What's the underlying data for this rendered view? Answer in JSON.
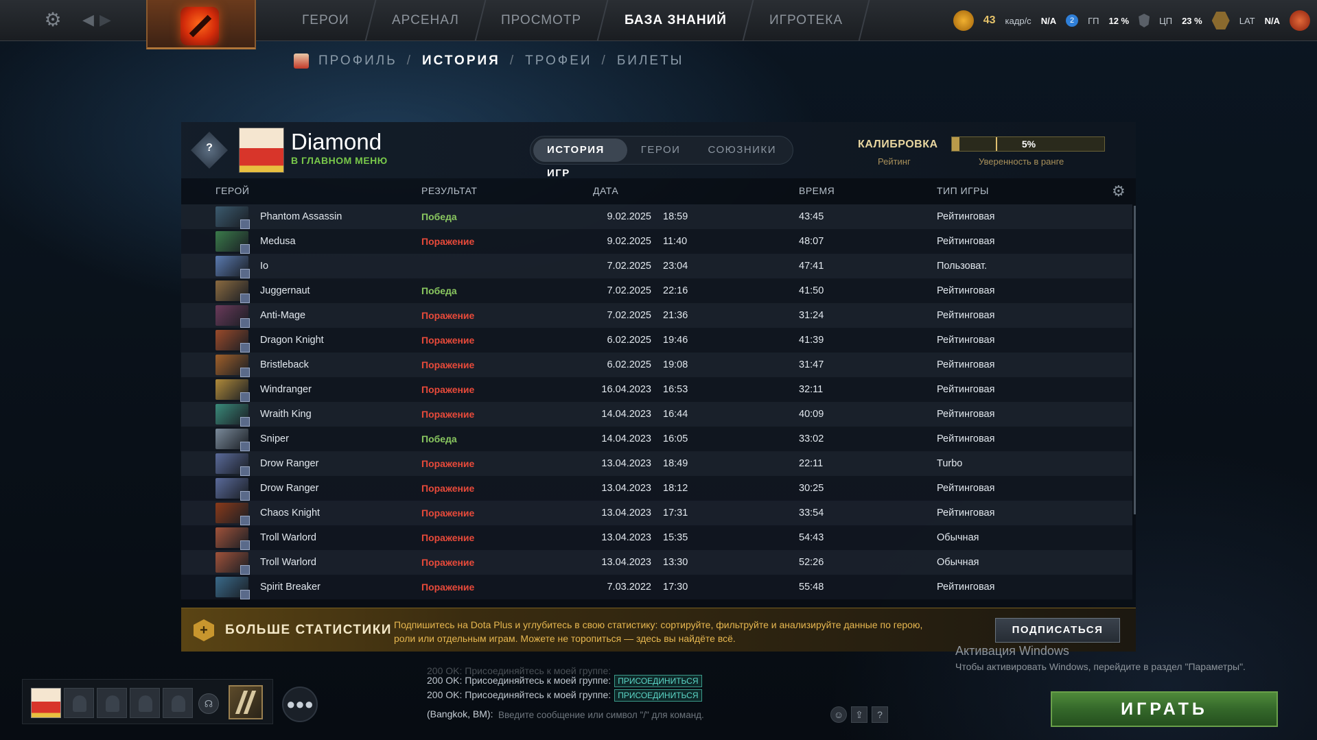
{
  "topbar": {
    "nav": [
      {
        "label": "ГЕРОИ",
        "active": false
      },
      {
        "label": "АРСЕНАЛ",
        "active": false
      },
      {
        "label": "ПРОСМОТР",
        "active": false
      },
      {
        "label": "БАЗА ЗНАНИЙ",
        "active": true
      },
      {
        "label": "ИГРОТЕКА",
        "active": false
      }
    ],
    "status": {
      "fps_value": "43",
      "fps_sub": "кадр/с",
      "loss_label": "N/A",
      "party_count": "2",
      "gpu_label": "ГП",
      "gpu_value": "12 %",
      "cpu_label": "ЦП",
      "cpu_value": "23 %",
      "lat_label": "LAT",
      "lat_value": "N/A"
    }
  },
  "subnav": {
    "items": [
      "ПРОФИЛЬ",
      "ИСТОРИЯ",
      "ТРОФЕИ",
      "БИЛЕТЫ"
    ],
    "active": "ИСТОРИЯ",
    "separator": "/"
  },
  "profile": {
    "rank_number": "?",
    "name": "Diamond",
    "status": "В ГЛАВНОМ МЕНЮ",
    "tabs": [
      {
        "label": "ИСТОРИЯ ИГР",
        "active": true
      },
      {
        "label": "ГЕРОИ",
        "active": false
      },
      {
        "label": "СОЮЗНИКИ",
        "active": false
      }
    ],
    "calibration_label": "КАЛИБРОВКА",
    "rating_label": "Рейтинг",
    "confidence_percent": 5,
    "confidence_text": "5%",
    "confidence_label": "Уверенность в ранге"
  },
  "table": {
    "headers": {
      "hero": "ГЕРОЙ",
      "result": "РЕЗУЛЬТАТ",
      "date": "ДАТА",
      "duration": "ВРЕМЯ",
      "game_type": "ТИП ИГРЫ"
    },
    "rows": [
      {
        "hero": "Phantom Assassin",
        "result": "Победа",
        "outcome": "win",
        "date": "9.02.2025",
        "time": "18:59",
        "duration": "43:45",
        "type": "Рейтинговая",
        "color": "#3b5a6e"
      },
      {
        "hero": "Medusa",
        "result": "Поражение",
        "outcome": "loss",
        "date": "9.02.2025",
        "time": "11:40",
        "duration": "48:07",
        "type": "Рейтинговая",
        "color": "#3a7a4a"
      },
      {
        "hero": "Io",
        "result": "",
        "outcome": "none",
        "date": "7.02.2025",
        "time": "23:04",
        "duration": "47:41",
        "type": "Пользоват.",
        "color": "#5a7ab0"
      },
      {
        "hero": "Juggernaut",
        "result": "Победа",
        "outcome": "win",
        "date": "7.02.2025",
        "time": "22:16",
        "duration": "41:50",
        "type": "Рейтинговая",
        "color": "#8a6a40"
      },
      {
        "hero": "Anti-Mage",
        "result": "Поражение",
        "outcome": "loss",
        "date": "7.02.2025",
        "time": "21:36",
        "duration": "31:24",
        "type": "Рейтинговая",
        "color": "#6a3a5a"
      },
      {
        "hero": "Dragon Knight",
        "result": "Поражение",
        "outcome": "loss",
        "date": "6.02.2025",
        "time": "19:46",
        "duration": "41:39",
        "type": "Рейтинговая",
        "color": "#9a4a2a"
      },
      {
        "hero": "Bristleback",
        "result": "Поражение",
        "outcome": "loss",
        "date": "6.02.2025",
        "time": "19:08",
        "duration": "31:47",
        "type": "Рейтинговая",
        "color": "#a0602a"
      },
      {
        "hero": "Windranger",
        "result": "Поражение",
        "outcome": "loss",
        "date": "16.04.2023",
        "time": "16:53",
        "duration": "32:11",
        "type": "Рейтинговая",
        "color": "#b08a3a"
      },
      {
        "hero": "Wraith King",
        "result": "Поражение",
        "outcome": "loss",
        "date": "14.04.2023",
        "time": "16:44",
        "duration": "40:09",
        "type": "Рейтинговая",
        "color": "#3a8a7a"
      },
      {
        "hero": "Sniper",
        "result": "Победа",
        "outcome": "win",
        "date": "14.04.2023",
        "time": "16:05",
        "duration": "33:02",
        "type": "Рейтинговая",
        "color": "#7a8a9a"
      },
      {
        "hero": "Drow Ranger",
        "result": "Поражение",
        "outcome": "loss",
        "date": "13.04.2023",
        "time": "18:49",
        "duration": "22:11",
        "type": "Turbo",
        "color": "#5a6a9a"
      },
      {
        "hero": "Drow Ranger",
        "result": "Поражение",
        "outcome": "loss",
        "date": "13.04.2023",
        "time": "18:12",
        "duration": "30:25",
        "type": "Рейтинговая",
        "color": "#5a6a9a"
      },
      {
        "hero": "Chaos Knight",
        "result": "Поражение",
        "outcome": "loss",
        "date": "13.04.2023",
        "time": "17:31",
        "duration": "33:54",
        "type": "Рейтинговая",
        "color": "#8a3a1a"
      },
      {
        "hero": "Troll Warlord",
        "result": "Поражение",
        "outcome": "loss",
        "date": "13.04.2023",
        "time": "15:35",
        "duration": "54:43",
        "type": "Обычная",
        "color": "#a0523a"
      },
      {
        "hero": "Troll Warlord",
        "result": "Поражение",
        "outcome": "loss",
        "date": "13.04.2023",
        "time": "13:30",
        "duration": "52:26",
        "type": "Обычная",
        "color": "#a0523a"
      },
      {
        "hero": "Spirit Breaker",
        "result": "Поражение",
        "outcome": "loss",
        "date": "7.03.2022",
        "time": "17:30",
        "duration": "55:48",
        "type": "Рейтинговая",
        "color": "#3a6a8a"
      }
    ]
  },
  "promo": {
    "title": "БОЛЬШЕ СТАТИСТИКИ",
    "description": "Подпишитесь на Dota Plus и углубитесь в свою статистику: сортируйте, фильтруйте и анализируйте данные по герою, роли или отдельным играм. Можете не торопиться — здесь вы найдёте всё.",
    "button": "ПОДПИСАТЬСЯ"
  },
  "watermark": {
    "title": "Активация Windows",
    "subtitle": "Чтобы активировать Windows, перейдите в раздел \"Параметры\"."
  },
  "chat": {
    "messages": [
      {
        "text": "200 OK: Присоединяйтесь к моей группе:",
        "button": "ПРИСОЕДИНИТЬСЯ"
      },
      {
        "text": "200 OK: Присоединяйтесь к моей группе:",
        "button": "ПРИСОЕДИНИТЬСЯ"
      }
    ],
    "channel": "(Bangkok, BM):",
    "placeholder": "Введите сообщение или символ \"/\" для команд.",
    "help": "?"
  },
  "play_button": "ИГРАТЬ",
  "colors": {
    "win": "#8ac860",
    "loss": "#e84a3a",
    "accent_gold": "#e8b850",
    "play_green": "#34682a"
  },
  "icons": {
    "settings": "gear-icon",
    "back": "chevron-left-icon",
    "forward": "chevron-right-icon",
    "voice": "headset-icon",
    "party": "group-icon",
    "emoji": "smile-icon",
    "share": "share-icon"
  }
}
